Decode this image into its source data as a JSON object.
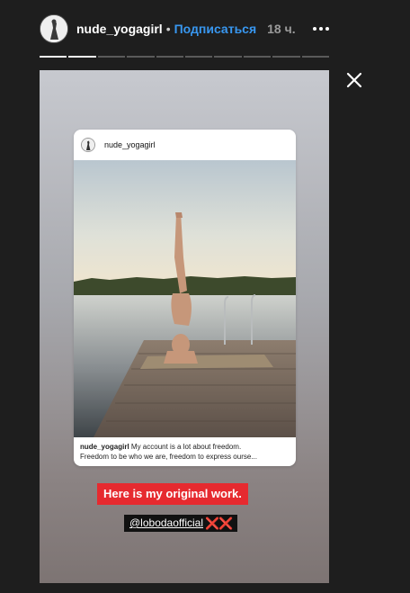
{
  "header": {
    "username": "nude_yogagirl",
    "separator": "•",
    "subscribe_label": "Подписаться",
    "time_ago": "18 ч."
  },
  "progress": {
    "segments_total": 10,
    "segments_completed": 2
  },
  "post": {
    "username": "nude_yogagirl",
    "caption_user": "nude_yogagirl",
    "caption_line1": " My account is a lot about freedom.",
    "caption_line2": "Freedom to be who we are, freedom to express ourse..."
  },
  "stickers": {
    "text": "Here is my original work.",
    "mention": "@lobodaofficial",
    "emoji": "❌❌"
  },
  "colors": {
    "accent": "#3897f0",
    "sticker_red": "#e62a2f"
  },
  "icons": {
    "close": "close-icon",
    "more": "more-options-icon"
  }
}
